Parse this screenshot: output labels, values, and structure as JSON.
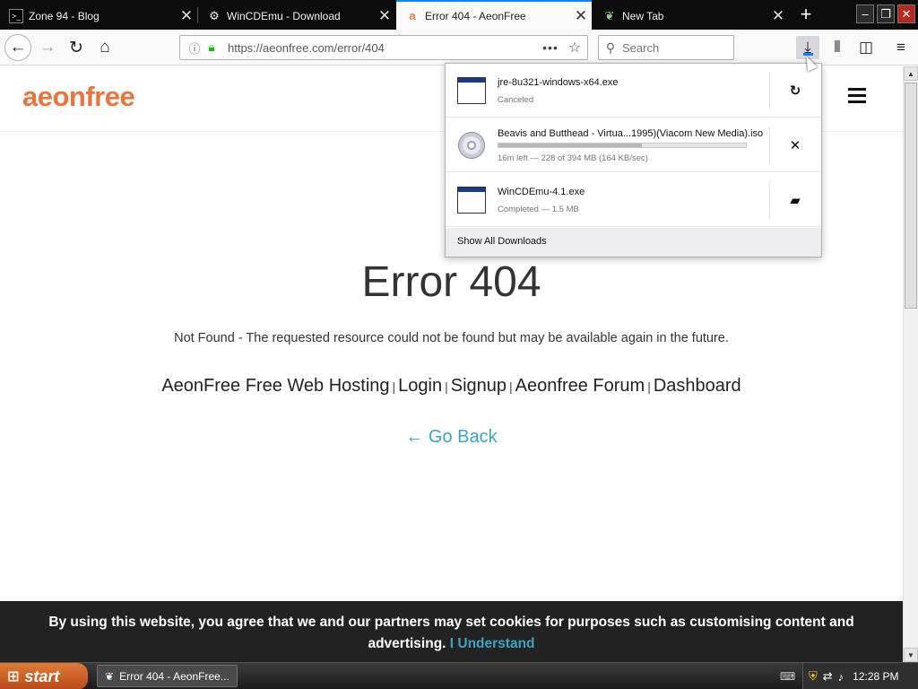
{
  "tabs": [
    {
      "title": "Zone 94 - Blog",
      "icon": "terminal-icon"
    },
    {
      "title": "WinCDEmu - Download",
      "icon": "gear-icon"
    },
    {
      "title": "Error 404 - AeonFree",
      "icon": "aeonfree-a-icon"
    },
    {
      "title": "New Tab",
      "icon": "new-tab-icon"
    }
  ],
  "address": {
    "url": "https://aeonfree.com/error/404"
  },
  "search": {
    "placeholder": "Search"
  },
  "page": {
    "logo": "aeonfree",
    "title": "Error 404",
    "description": "Not Found - The requested resource could not be found but may be available again in the future.",
    "links": [
      "AeonFree Free Web Hosting",
      "Login",
      "Signup",
      "Aeonfree Forum",
      "Dashboard"
    ],
    "separator": "|",
    "go_back": "← Go Back"
  },
  "cookie": {
    "text": "By using this website, you agree that we and our partners may set cookies for purposes such as customising content and advertising.",
    "accept": "I Understand"
  },
  "downloads": {
    "items": [
      {
        "name": "jre-8u321-windows-x64.exe",
        "status": "Canceled",
        "action": "retry",
        "progress": null
      },
      {
        "name": "Beavis and Butthead - Virtua...1995)(Viacom New Media).iso",
        "status": "16m left — 228 of 394 MB (164 KB/sec)",
        "action": "cancel",
        "progress": 0.58
      },
      {
        "name": "WinCDEmu-4.1.exe",
        "status": "Completed — 1.5 MB",
        "action": "open-folder",
        "progress": null
      }
    ],
    "footer": "Show All Downloads"
  },
  "taskbar": {
    "start_label": "start",
    "task": "Error 404 - AeonFree...",
    "clock": "12:28 PM"
  },
  "colors": {
    "brand": "#e8753f",
    "link": "#3ba3c3",
    "active_tab_accent": "#0a84ff",
    "cookie_bg": "#222222"
  }
}
